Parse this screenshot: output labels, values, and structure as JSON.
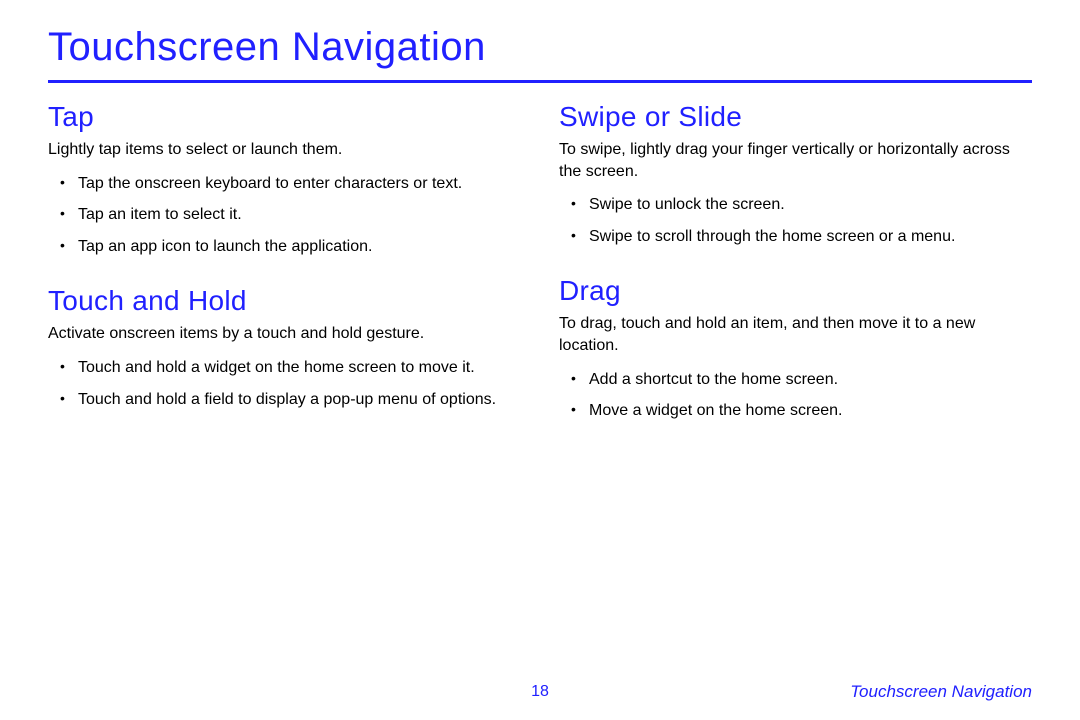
{
  "title": "Touchscreen Navigation",
  "left": {
    "tap": {
      "heading": "Tap",
      "intro": "Lightly tap items to select or launch them.",
      "items": [
        "Tap the onscreen keyboard to enter characters or text.",
        "Tap an item to select it.",
        "Tap an app icon to launch the application."
      ]
    },
    "touch_hold": {
      "heading": "Touch and Hold",
      "intro": "Activate onscreen items by a touch and hold gesture.",
      "items": [
        "Touch and hold a widget on the home screen to move it.",
        "Touch and hold a field to display a pop-up menu of options."
      ]
    }
  },
  "right": {
    "swipe": {
      "heading": "Swipe or Slide",
      "intro": "To swipe, lightly drag your finger vertically or horizontally across the screen.",
      "items": [
        "Swipe to unlock the screen.",
        "Swipe to scroll through the home screen or a menu."
      ]
    },
    "drag": {
      "heading": "Drag",
      "intro": "To drag, touch and hold an item, and then move it to a new location.",
      "items": [
        "Add a shortcut to the home screen.",
        "Move a widget on the home screen."
      ]
    }
  },
  "footer": {
    "page": "18",
    "section": "Touchscreen Navigation"
  }
}
